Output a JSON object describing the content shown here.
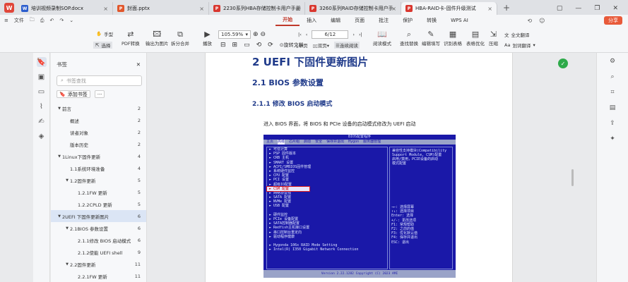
{
  "tabs": [
    {
      "label": "培训视频录制SOP.docx",
      "color": "#2b5dcd",
      "icon": "W"
    },
    {
      "label": "封面.pptx",
      "color": "#e1572c",
      "icon": "P"
    },
    {
      "label": "2230系列HBA存储控制卡用户手册",
      "color": "#d9372f",
      "icon": "P"
    },
    {
      "label": "3260系列RAID存储控制卡用户手",
      "color": "#d9372f",
      "icon": "P"
    },
    {
      "label": "HBA-RAID卡-固件升级测试",
      "color": "#d9372f",
      "icon": "P"
    }
  ],
  "menubar": {
    "file": "文件",
    "items": [
      "开始",
      "插入",
      "编辑",
      "页面",
      "批注",
      "保护",
      "转换",
      "WPS AI"
    ],
    "active": "开始",
    "share": "分享"
  },
  "toolbar": {
    "hand": "手型",
    "select": "选择",
    "pdf_convert": "PDF转换",
    "export_img": "输出为图片",
    "split_merge": "拆分合并",
    "play": "播放",
    "zoom": "105.59%",
    "page": "6/12",
    "rotate_doc": "旋转文档",
    "single": "单页",
    "double": "双页",
    "continuous": "连续阅读",
    "read_mode": "阅读模式",
    "find_replace": "查找替换",
    "edit_fill": "编辑填写",
    "ocr_table": "识别表格",
    "table_convert": "表格优化",
    "compress": "压缩",
    "full_translate": "全文翻译",
    "word_translate": "划词翻译"
  },
  "nav": {
    "title": "书签",
    "search_placeholder": "书签查找",
    "add_bookmark": "添加书签",
    "items": [
      {
        "label": "前言",
        "page": "2",
        "level": 0,
        "toggle": "open"
      },
      {
        "label": "概述",
        "page": "2",
        "level": 1,
        "toggle": ""
      },
      {
        "label": "读者对象",
        "page": "2",
        "level": 1,
        "toggle": ""
      },
      {
        "label": "版本历史",
        "page": "2",
        "level": 1,
        "toggle": ""
      },
      {
        "label": "1Linux下固件更新",
        "page": "4",
        "level": 0,
        "toggle": "open"
      },
      {
        "label": "1.1系统环境准备",
        "page": "4",
        "level": 1,
        "toggle": ""
      },
      {
        "label": "1.2固件更新",
        "page": "5",
        "level": 1,
        "toggle": "open"
      },
      {
        "label": "1.2.1FW 更新",
        "page": "5",
        "level": 2,
        "toggle": ""
      },
      {
        "label": "1.2.2CPLD 更新",
        "page": "5",
        "level": 2,
        "toggle": ""
      },
      {
        "label": "2UEFI 下固件更新图片",
        "page": "6",
        "level": 0,
        "toggle": "open",
        "selected": true
      },
      {
        "label": "2.1BIOS 参数设置",
        "page": "6",
        "level": 1,
        "toggle": "open"
      },
      {
        "label": "2.1.1修改 BIOS 启动模式",
        "page": "6",
        "level": 2,
        "toggle": ""
      },
      {
        "label": "2.1.2使能 UEFI shell",
        "page": "9",
        "level": 2,
        "toggle": ""
      },
      {
        "label": "2.2固件更新",
        "page": "11",
        "level": 1,
        "toggle": "open"
      },
      {
        "label": "2.2.1FW 更新",
        "page": "11",
        "level": 2,
        "toggle": ""
      }
    ]
  },
  "doc": {
    "h1": "2 UEFI 下固件更新图片",
    "h2": "2.1 BIOS 参数设置",
    "h3": "2.1.1 修改 BIOS 启动模式",
    "para": "进入 BIOS 界面，将 BIOS 和 PCIe 设备的启动模式修改为 UEFI 启动"
  },
  "bios": {
    "title": "BIOS配置程序",
    "menu": [
      "主页",
      "高级",
      "芯片组",
      "启动",
      "安全",
      "保存并退出",
      "Hygon",
      "服务器管理"
    ],
    "menu_active": "高级",
    "left_lines": [
      "► 可信计算",
      "► PSP 固件版本",
      "► CRB 主机",
      "► SMART 设置",
      "► ACPI/SMBIOS固件管理",
      "► 系统硬件监控",
      "► CPU 配置",
      "► PCI 设置",
      "► 超级IO配置",
      "► CSM 配置",
      "► 网络协议栈",
      "► SATA 配置",
      "► NVMe 配置",
      "► USB 配置",
      "",
      "► 硬件监控",
      "► PCIe 设备配置",
      "► SATA控制器配置",
      "► Redfish主机接口设置",
      "► 串口控制台重定向",
      "► 驱动程序健康",
      "",
      "► Hygonda 106x RAID Mode Setting",
      "► Intel(R) I350 Gigabit Network Connection"
    ],
    "highlighted_index": 9,
    "help": [
      "兼容性支持模块(Compatibility",
      "Support Module, CSM)配置",
      "启用/禁用，PCIE设备的启动",
      "模式配置"
    ],
    "keys": [
      "→←: 选择屏幕",
      "↑↓: 选择项目",
      "Enter: 选择",
      "+/-: 更改选项",
      "F1: 常规帮助",
      "F2: 之前的值",
      "F3: 优化默认值",
      "F4: 保存并退出",
      "ESC: 退出"
    ],
    "footer": "Version 2.22.1282 Copyright (C) 2023 AMI"
  }
}
